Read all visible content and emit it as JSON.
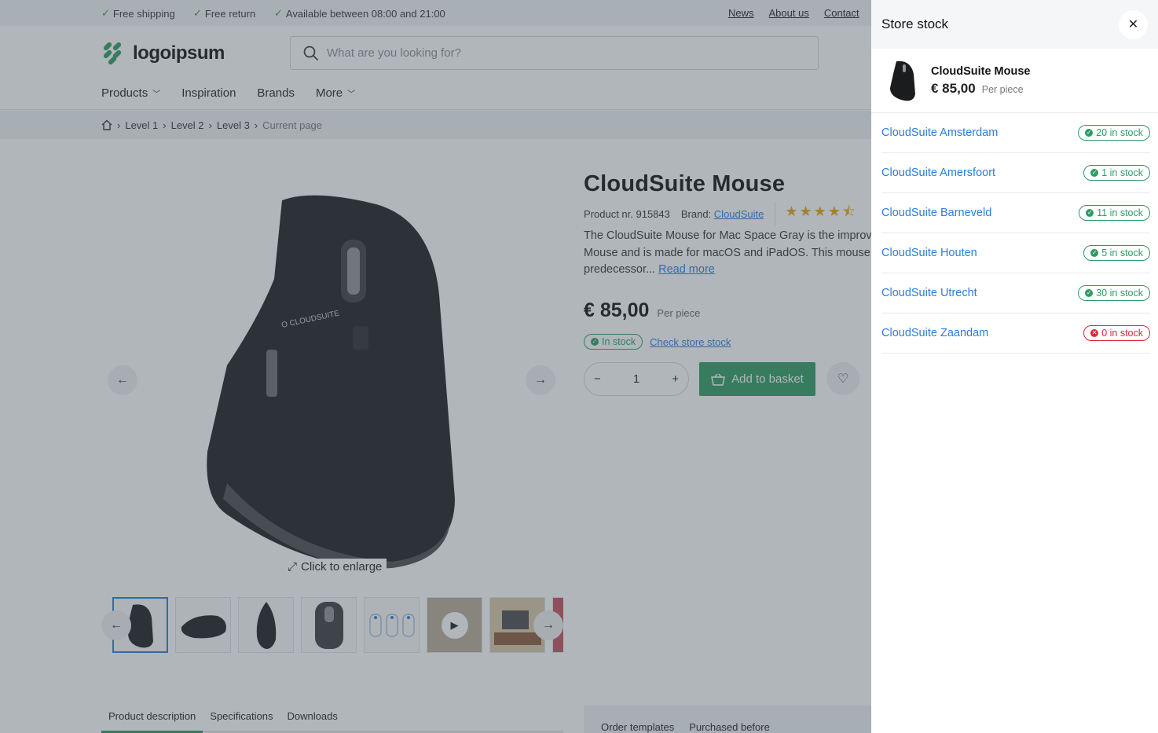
{
  "topbar": {
    "usps": [
      "Free shipping",
      "Free return",
      "Available between 08:00 and 21:00"
    ],
    "links": [
      "News",
      "About us",
      "Contact"
    ]
  },
  "header": {
    "logo_text": "logoipsum",
    "search_placeholder": "What are you looking for?",
    "nav": [
      "Products",
      "Inspiration",
      "Brands",
      "More"
    ]
  },
  "breadcrumb": [
    "Level 1",
    "Level 2",
    "Level 3",
    "Current page"
  ],
  "gallery": {
    "enlarge_label": "Click to enlarge",
    "icons": [
      "arrow-left-icon",
      "arrow-right-icon",
      "expand-icon",
      "play-icon"
    ]
  },
  "product": {
    "title": "CloudSuite Mouse",
    "number_label": "Product nr. 915843",
    "brand_label": "Brand:",
    "brand": "CloudSuite",
    "rating": 4.5,
    "desc_line1": "The CloudSuite Mouse for Mac Space Gray is the improved",
    "desc_line2": "Mouse and is made for macOS and iPadOS. This mouse is",
    "desc_line3": "predecessor...",
    "read_more": "Read more",
    "price": "€ 85,00",
    "unit": "Per piece",
    "stock_status": "In stock",
    "check_store": "Check store stock",
    "quantity": "1",
    "add_to_basket": "Add to basket"
  },
  "tabs": [
    "Product description",
    "Specifications",
    "Downloads"
  ],
  "side_tabs": [
    "Order templates",
    "Purchased before"
  ],
  "drawer": {
    "title": "Store stock",
    "product_name": "CloudSuite Mouse",
    "product_price": "€ 85,00",
    "product_unit": "Per piece",
    "stores": [
      {
        "name": "CloudSuite Amsterdam",
        "stock": "20 in stock",
        "available": true
      },
      {
        "name": "CloudSuite Amersfoort",
        "stock": "1 in stock",
        "available": true
      },
      {
        "name": "CloudSuite Barneveld",
        "stock": "11 in stock",
        "available": true
      },
      {
        "name": "CloudSuite Houten",
        "stock": "5 in stock",
        "available": true
      },
      {
        "name": "CloudSuite Utrecht",
        "stock": "30 in stock",
        "available": true
      },
      {
        "name": "CloudSuite Zaandam",
        "stock": "0 in stock",
        "available": false
      }
    ]
  },
  "colors": {
    "accent": "#2e9b62",
    "link": "#2a7de1",
    "out_of_stock": "#d9283c"
  }
}
